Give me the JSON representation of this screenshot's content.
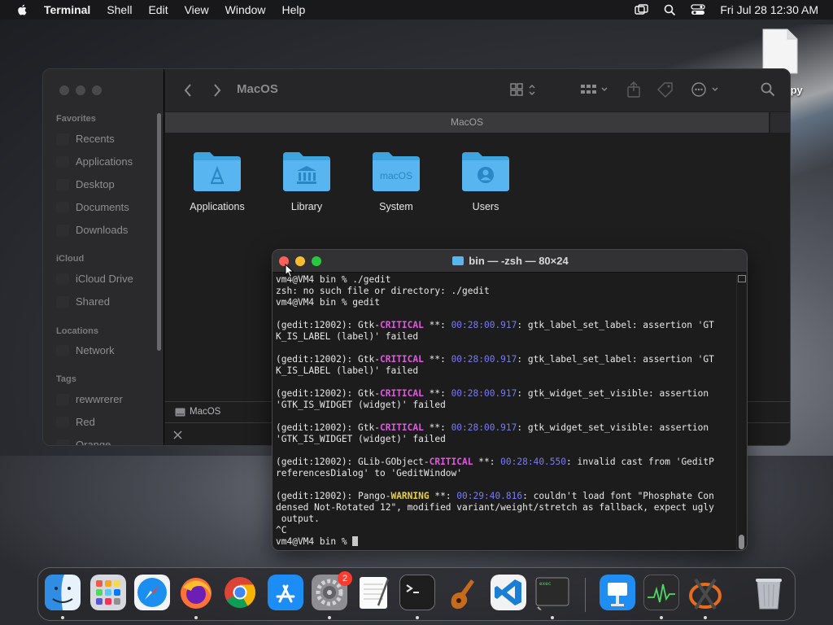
{
  "menubar": {
    "app_name": "Terminal",
    "menus": [
      "Shell",
      "Edit",
      "View",
      "Window",
      "Help"
    ],
    "clock": "Fri Jul 28  12:30 AM"
  },
  "desktop": {
    "file_label": ".py"
  },
  "finder": {
    "title": "MacOS",
    "path_header": "MacOS",
    "sidebar": {
      "favorites_header": "Favorites",
      "favorites": [
        "Recents",
        "Applications",
        "Desktop",
        "Documents",
        "Downloads"
      ],
      "icloud_header": "iCloud",
      "icloud": [
        "iCloud Drive",
        "Shared"
      ],
      "locations_header": "Locations",
      "locations": [
        "Network"
      ],
      "tags_header": "Tags",
      "tags": [
        "rewwrerer",
        "Red",
        "Orange"
      ]
    },
    "folders": [
      {
        "label": "Applications",
        "glyph": "A"
      },
      {
        "label": "Library",
        "glyph": ""
      },
      {
        "label": "System",
        "glyph": "macOS"
      },
      {
        "label": "Users",
        "glyph": ""
      }
    ],
    "status_path": "MacOS"
  },
  "terminal": {
    "title": "bin — -zsh — 80×24",
    "lines": [
      [
        {
          "t": "vm4@VM4 bin % ./gedit"
        }
      ],
      [
        {
          "t": "zsh: no such file or directory: ./gedit"
        }
      ],
      [
        {
          "t": "vm4@VM4 bin % gedit"
        }
      ],
      [
        {
          "t": ""
        }
      ],
      [
        {
          "t": "(gedit:12002): Gtk-"
        },
        {
          "t": "CRITICAL",
          "c": "crit"
        },
        {
          "t": " **: "
        },
        {
          "t": "00:28:00.917",
          "c": "ts"
        },
        {
          "t": ": gtk_label_set_label: assertion 'GT"
        }
      ],
      [
        {
          "t": "K_IS_LABEL (label)' failed"
        }
      ],
      [
        {
          "t": ""
        }
      ],
      [
        {
          "t": "(gedit:12002): Gtk-"
        },
        {
          "t": "CRITICAL",
          "c": "crit"
        },
        {
          "t": " **: "
        },
        {
          "t": "00:28:00.917",
          "c": "ts"
        },
        {
          "t": ": gtk_label_set_label: assertion 'GT"
        }
      ],
      [
        {
          "t": "K_IS_LABEL (label)' failed"
        }
      ],
      [
        {
          "t": ""
        }
      ],
      [
        {
          "t": "(gedit:12002): Gtk-"
        },
        {
          "t": "CRITICAL",
          "c": "crit"
        },
        {
          "t": " **: "
        },
        {
          "t": "00:28:00.917",
          "c": "ts"
        },
        {
          "t": ": gtk_widget_set_visible: assertion"
        }
      ],
      [
        {
          "t": "'GTK_IS_WIDGET (widget)' failed"
        }
      ],
      [
        {
          "t": ""
        }
      ],
      [
        {
          "t": "(gedit:12002): Gtk-"
        },
        {
          "t": "CRITICAL",
          "c": "crit"
        },
        {
          "t": " **: "
        },
        {
          "t": "00:28:00.917",
          "c": "ts"
        },
        {
          "t": ": gtk_widget_set_visible: assertion"
        }
      ],
      [
        {
          "t": "'GTK_IS_WIDGET (widget)' failed"
        }
      ],
      [
        {
          "t": ""
        }
      ],
      [
        {
          "t": "(gedit:12002): GLib-GObject-"
        },
        {
          "t": "CRITICAL",
          "c": "crit"
        },
        {
          "t": " **: "
        },
        {
          "t": "00:28:40.550",
          "c": "ts"
        },
        {
          "t": ": invalid cast from 'GeditP"
        }
      ],
      [
        {
          "t": "referencesDialog' to 'GeditWindow'"
        }
      ],
      [
        {
          "t": ""
        }
      ],
      [
        {
          "t": "(gedit:12002): Pango-"
        },
        {
          "t": "WARNING",
          "c": "warn"
        },
        {
          "t": " **: "
        },
        {
          "t": "00:29:40.816",
          "c": "ts"
        },
        {
          "t": ": couldn't load font \"Phosphate Con"
        }
      ],
      [
        {
          "t": "densed Not-Rotated 12\", modified variant/weight/stretch as fallback, expect ugly"
        }
      ],
      [
        {
          "t": " output."
        }
      ],
      [
        {
          "t": "^C"
        }
      ],
      [
        {
          "t": "vm4@VM4 bin % "
        },
        {
          "t": "",
          "c": "cursor"
        }
      ]
    ]
  },
  "dock": {
    "apps": [
      "finder",
      "launchpad",
      "safari",
      "firefox",
      "chrome",
      "app-store",
      "system-settings",
      "textedit",
      "terminal",
      "garageband",
      "vscode",
      "exec",
      "keynote",
      "activity-monitor",
      "x11"
    ],
    "system_settings_badge": "2"
  },
  "colors": {
    "folder_blue": "#58b5ef",
    "critical": "#e058e0",
    "warning": "#e8d040",
    "timestamp": "#7a7af0"
  }
}
